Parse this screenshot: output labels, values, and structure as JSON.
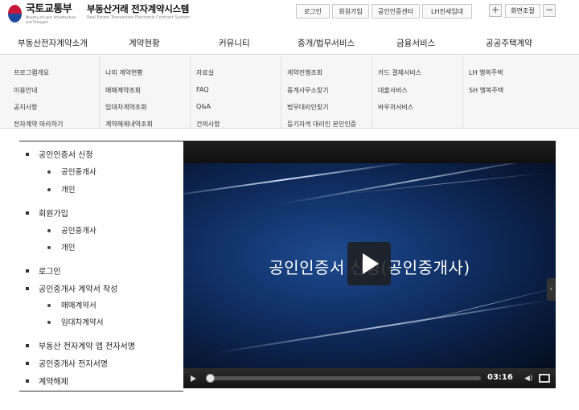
{
  "header": {
    "logo_name": "국토교통부",
    "logo_sub": "Ministry of Land, Infrastructure and Transport",
    "system_title": "부동산거래 전자계약시스템",
    "system_sub": "Real Estate Transaction Electronic Contract System",
    "top_links": [
      "로그인",
      "회원가입",
      "공인인증센터",
      "LH전세임대"
    ],
    "zoom_in": "+",
    "zoom_label": "화면조절",
    "zoom_out": "−"
  },
  "gnb": [
    "부동산전자계약소개",
    "계약현황",
    "커뮤니티",
    "중개/법무서비스",
    "금융서비스",
    "공공주택계약"
  ],
  "mega_menu": [
    [
      "프로그램개요",
      "이용안내",
      "공지사항",
      "전자계약 따라하기"
    ],
    [
      "나의 계약현황",
      "매매계약조회",
      "임대차계약조회",
      "계약해제내역조회"
    ],
    [
      "자료실",
      "FAQ",
      "Q&A",
      "건의사항"
    ],
    [
      "계약진행조회",
      "중개사무소찾기",
      "법무대리인찾기",
      "등기자격 대리인 본인인증"
    ],
    [
      "카드 결제서비스",
      "대출서비스",
      "바우처서비스"
    ],
    [
      "LH 행복주택",
      "SH 행복주택"
    ]
  ],
  "left_list": {
    "cert": "공인인증서 신청",
    "cert_sub": [
      "공인중개사",
      "개인"
    ],
    "join": "회원가입",
    "join_sub": [
      "공인중개사",
      "개인"
    ],
    "login": "로그인",
    "write": "공인중개사 계약서 작성",
    "write_sub": [
      "매매계약서",
      "임대차계약서"
    ],
    "app_sign": "부동산 전자계약 앱 전자서명",
    "agent_sign": "공인중개사 전자서명",
    "cancel": "계약해제"
  },
  "video": {
    "title": "공인인증서 신청(공인중개사)",
    "time": "03:16",
    "progress": 0.0,
    "side_tab": "‹",
    "volume_icon": "◀)"
  },
  "colors": {
    "emblem_red": "#c7173b",
    "emblem_blue": "#1c4a9c",
    "video_bg": "#12336b"
  }
}
